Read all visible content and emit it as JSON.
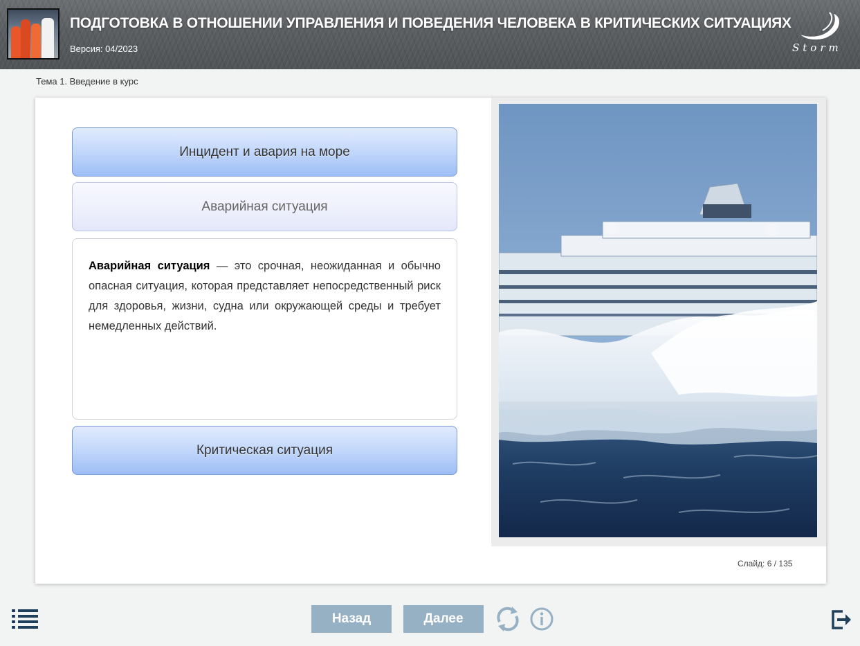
{
  "header": {
    "title": "ПОДГОТОВКА В ОТНОШЕНИИ УПРАВЛЕНИЯ И ПОВЕДЕНИЯ ЧЕЛОВЕКА В КРИТИЧЕСКИХ СИТУАЦИЯХ",
    "version": "Версия: 04/2023",
    "logo_text": "Storm"
  },
  "breadcrumb": "Тема 1. Введение в курс",
  "accordion": {
    "items": [
      {
        "label": "Инцидент и авария на море",
        "state": "collapsed"
      },
      {
        "label": "Аварийная ситуация",
        "state": "expanded"
      },
      {
        "label": "Критическая ситуация",
        "state": "collapsed"
      }
    ],
    "expanded_term": "Аварийная ситуация",
    "expanded_text": " — это срочная, неожиданная и обычно опасная ситуация, которая представляет непосредственный риск для здоровья, жизни, судна или окружающей среды и требует немедленных действий."
  },
  "image": {
    "subject": "cruise-ship-in-storm"
  },
  "slide_counter": "Слайд:  6 / 135",
  "footer": {
    "back_label": "Назад",
    "next_label": "Далее"
  },
  "icons": {
    "menu": "list-icon",
    "refresh": "refresh-icon",
    "info": "info-icon",
    "exit": "exit-icon"
  },
  "colors": {
    "nav_button": "#96b0c4",
    "accent_icon": "#1f3f5a",
    "accordion_closed": "#c2d7fb"
  }
}
